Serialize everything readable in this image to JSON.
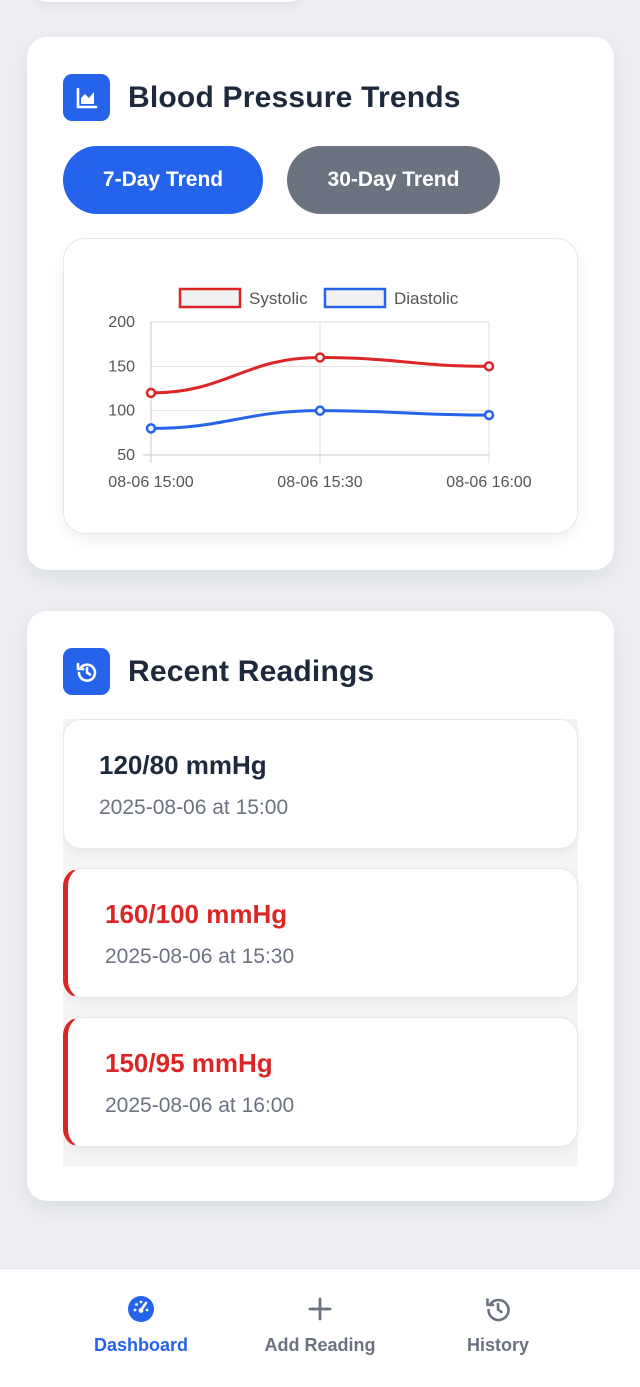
{
  "trends": {
    "title": "Blood Pressure Trends",
    "icon": "area-chart-icon",
    "buttons": {
      "seven_day": "7-Day Trend",
      "thirty_day": "30-Day Trend"
    }
  },
  "chart_data": {
    "type": "line",
    "title": "",
    "xlabel": "",
    "ylabel": "",
    "categories": [
      "08-06 15:00",
      "08-06 15:30",
      "08-06 16:00"
    ],
    "series": [
      {
        "name": "Systolic",
        "values": [
          120,
          160,
          150
        ],
        "color": "#dc2626"
      },
      {
        "name": "Diastolic",
        "values": [
          80,
          100,
          95
        ],
        "color": "#2563eb"
      }
    ],
    "ylim": [
      50,
      200
    ],
    "yticks": [
      50,
      100,
      150,
      200
    ],
    "grid": true,
    "legend": "top-center"
  },
  "readings": {
    "title": "Recent Readings",
    "icon": "history-icon",
    "items": [
      {
        "value": "120/80 mmHg",
        "time": "2025-08-06 at 15:00",
        "alert": false
      },
      {
        "value": "160/100 mmHg",
        "time": "2025-08-06 at 15:30",
        "alert": true
      },
      {
        "value": "150/95 mmHg",
        "time": "2025-08-06 at 16:00",
        "alert": true
      }
    ]
  },
  "nav": {
    "dashboard": "Dashboard",
    "add_reading": "Add Reading",
    "history": "History",
    "active": "dashboard",
    "accent": "#2563eb"
  }
}
